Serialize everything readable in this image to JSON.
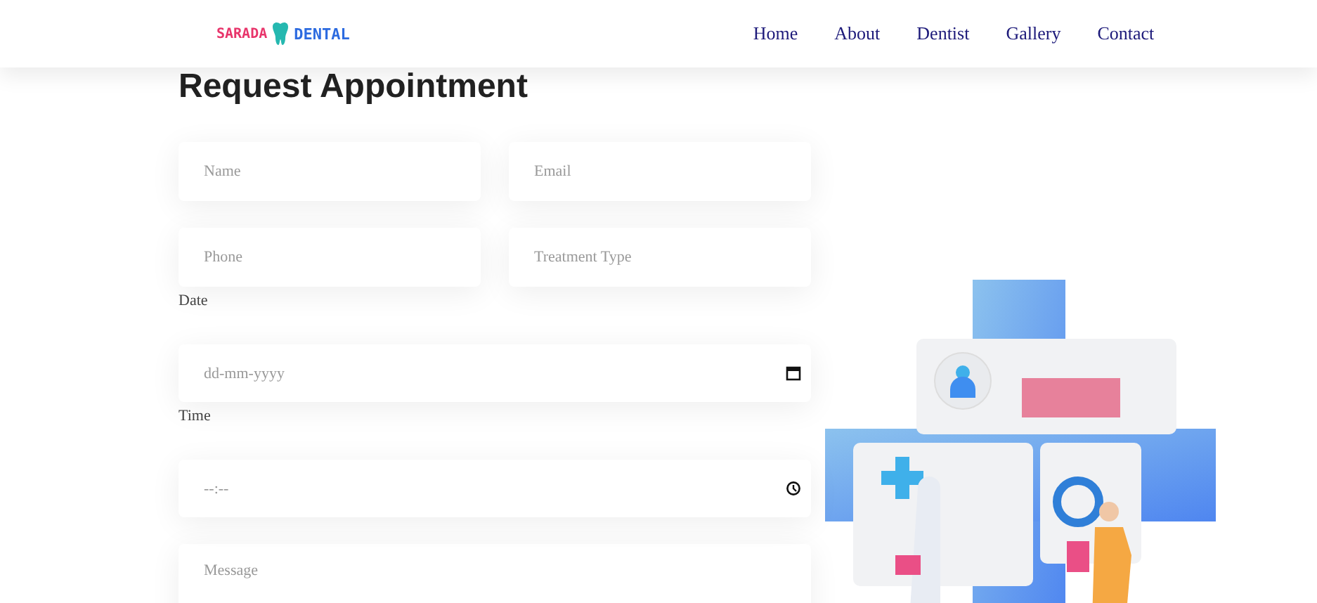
{
  "header": {
    "logo": {
      "left": "SARADA",
      "right": "DENTAL"
    },
    "nav": [
      {
        "label": "Home"
      },
      {
        "label": "About"
      },
      {
        "label": "Dentist"
      },
      {
        "label": "Gallery"
      },
      {
        "label": "Contact"
      }
    ]
  },
  "form": {
    "title": "Request Appointment",
    "fields": [
      {
        "kind": "text",
        "placeholder": "Name"
      },
      {
        "kind": "text",
        "placeholder": "Email"
      },
      {
        "kind": "text",
        "placeholder": "Phone"
      },
      {
        "kind": "text",
        "placeholder": "Treatment Type"
      }
    ],
    "date": {
      "label": "Date",
      "placeholder": "dd-mm-yyyy"
    },
    "time": {
      "label": "Time",
      "placeholder": "--:--"
    },
    "message": {
      "placeholder": "Message"
    }
  }
}
